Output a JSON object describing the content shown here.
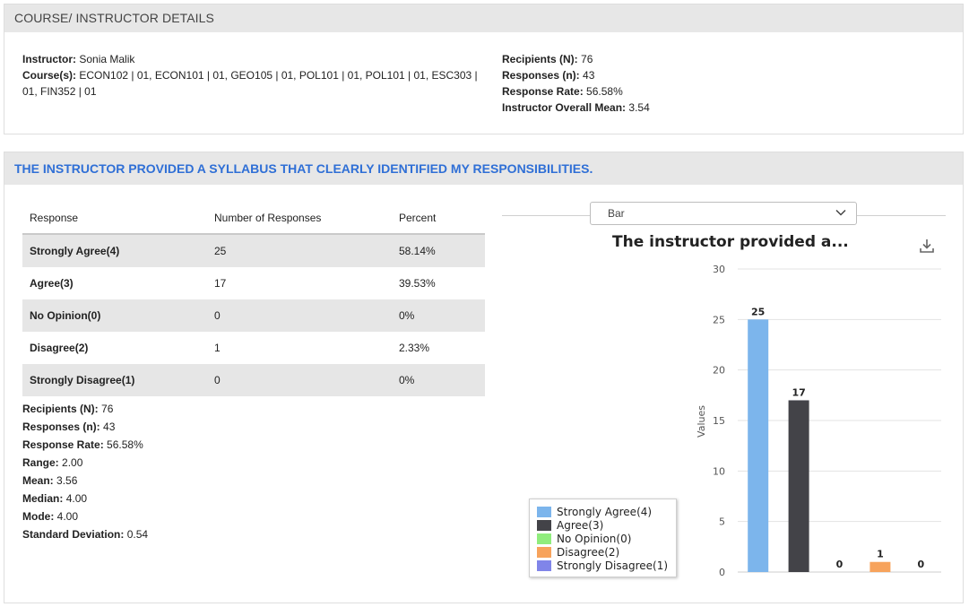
{
  "details": {
    "header": "COURSE/ INSTRUCTOR DETAILS",
    "instructor_label": "Instructor:",
    "instructor": "Sonia Malik",
    "courses_label": "Course(s):",
    "courses_line1": "ECON102 | 01, ECON101 | 01, GEO105 | 01, POL101 | 01, POL101 | 01, ESC303 |",
    "courses_line2": "01, FIN352 | 01",
    "recipients_label": "Recipients (N):",
    "recipients": "76",
    "responses_label": "Responses (n):",
    "responses": "43",
    "rate_label": "Response Rate:",
    "rate": "56.58%",
    "overall_label": "Instructor Overall Mean:",
    "overall": "3.54"
  },
  "question": {
    "title": "THE INSTRUCTOR PROVIDED A SYLLABUS THAT CLEARLY IDENTIFIED MY RESPONSIBILITIES.",
    "columns": [
      "Response",
      "Number of Responses",
      "Percent"
    ],
    "rows": [
      {
        "label": "Strongly Agree(4)",
        "count": "25",
        "percent": "58.14%"
      },
      {
        "label": "Agree(3)",
        "count": "17",
        "percent": "39.53%"
      },
      {
        "label": "No Opinion(0)",
        "count": "0",
        "percent": "0%"
      },
      {
        "label": "Disagree(2)",
        "count": "1",
        "percent": "2.33%"
      },
      {
        "label": "Strongly Disagree(1)",
        "count": "0",
        "percent": "0%"
      }
    ],
    "stats": [
      {
        "label": "Recipients (N):",
        "value": "76"
      },
      {
        "label": "Responses (n):",
        "value": "43"
      },
      {
        "label": "Response Rate:",
        "value": "56.58%"
      },
      {
        "label": "Range:",
        "value": "2.00"
      },
      {
        "label": "Mean:",
        "value": "3.56"
      },
      {
        "label": "Median:",
        "value": "4.00"
      },
      {
        "label": "Mode:",
        "value": "4.00"
      },
      {
        "label": "Standard Deviation:",
        "value": "0.54"
      }
    ]
  },
  "chart_select": {
    "selected": "Bar",
    "icon": "chevron-down-icon"
  },
  "download_icon": "download-icon",
  "chart_data": {
    "type": "bar",
    "title": "The instructor provided a...",
    "ylabel": "Values",
    "xlabel": "",
    "ylim": [
      0,
      30
    ],
    "yticks": [
      0,
      5,
      10,
      15,
      20,
      25,
      30
    ],
    "grid": true,
    "legend_position": "bottom-left",
    "categories": [
      "Strongly Agree(4)",
      "Agree(3)",
      "No Opinion(0)",
      "Disagree(2)",
      "Strongly Disagree(1)"
    ],
    "values": [
      25,
      17,
      0,
      1,
      0
    ],
    "colors": [
      "#7cb5ec",
      "#434348",
      "#90ed7d",
      "#f7a35c",
      "#8085e9"
    ]
  }
}
